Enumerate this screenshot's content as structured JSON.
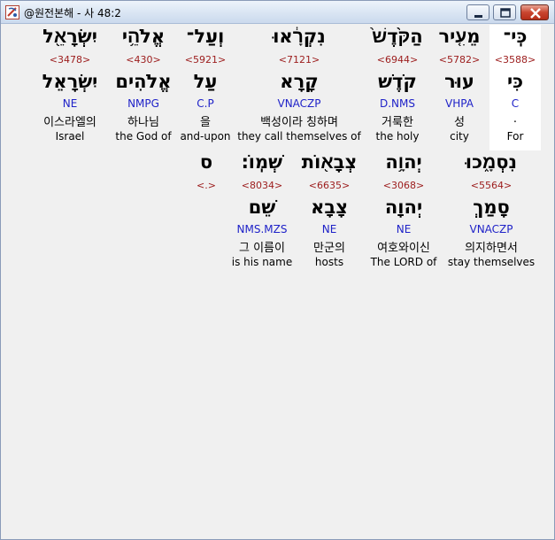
{
  "window": {
    "title": "@원전본해 - 사 48:2",
    "colors": {
      "strong": "#9c1c1c",
      "morph": "#1f22c8"
    }
  },
  "words": [
    {
      "hebrew": "כִּֽי־",
      "strong": "<3588>",
      "lemma": "כִּי",
      "morph": "C",
      "korean": ".",
      "english": "For",
      "highlighted": true
    },
    {
      "hebrew": "מֵעִ֤יר",
      "strong": "<5782>",
      "lemma": "עוּר",
      "morph": "VHPA",
      "korean": "성",
      "english": "city"
    },
    {
      "hebrew": "הַקֹּ֙דֶשׁ֙",
      "strong": "<6944>",
      "lemma": "קֹדֶשׁ",
      "morph": "D.NMS",
      "korean": "거룩한",
      "english": "the holy"
    },
    {
      "hebrew": "נִקְרָ֔אוּ",
      "strong": "<7121>",
      "lemma": "קָרָא",
      "morph": "VNACZP",
      "korean": "백성이라 칭하며",
      "english": "they call themselves of"
    },
    {
      "hebrew": "וְעַל־",
      "strong": "<5921>",
      "lemma": "עַל",
      "morph": "C.P",
      "korean": "을",
      "english": "and-upon"
    },
    {
      "hebrew": "אֱלֹהֵ֥י",
      "strong": "<430>",
      "lemma": "אֱלֹהִים",
      "morph": "NMPG",
      "korean": "하나님",
      "english": "the God of"
    },
    {
      "hebrew": "יִשְׂרָאֵ֖ל",
      "strong": "<3478>",
      "lemma": "יִשְׂרָאֵל",
      "morph": "NE",
      "korean": "이스라엘의",
      "english": "Israel"
    },
    {
      "hebrew": "נִסְמָ֑כוּ",
      "strong": "<5564>",
      "lemma": "סָמַךְ",
      "morph": "VNACZP",
      "korean": "의지하면서",
      "english": "stay themselves"
    },
    {
      "hebrew": "יְהוָ֥ה",
      "strong": "<3068>",
      "lemma": "יְהוָה",
      "morph": "NE",
      "korean": "여호와이신",
      "english": "The LORD of"
    },
    {
      "hebrew": "צְבָא֖וֹת",
      "strong": "<6635>",
      "lemma": "צָבָא",
      "morph": "NE",
      "korean": "만군의",
      "english": "hosts"
    },
    {
      "hebrew": "שְׁמֽוֹ׃",
      "strong": "<8034>",
      "lemma": "שֵׁם",
      "morph": "NMS.MZS",
      "korean": "그 이름이",
      "english": "is his name"
    },
    {
      "hebrew": "ס",
      "strong": "<.>",
      "lemma": "",
      "morph": "",
      "korean": "",
      "english": ""
    }
  ]
}
